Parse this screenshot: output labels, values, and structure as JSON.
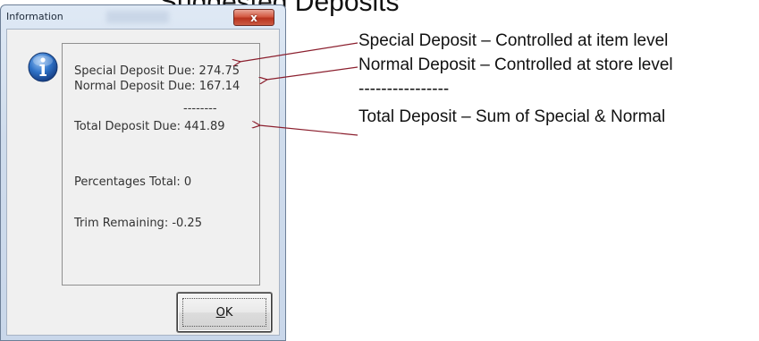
{
  "slide": {
    "title": "Suggested Deposits"
  },
  "dialog": {
    "title": "Information",
    "close_label": "x",
    "lines": {
      "special": "Special Deposit Due: 274.75",
      "normal": "Normal Deposit Due: 167.14",
      "separator": "--------",
      "total": "Total Deposit Due:   441.89",
      "percentages": "Percentages Total:  0",
      "trim": "Trim Remaining:  -0.25"
    },
    "ok_label_first": "O",
    "ok_label_rest": "K"
  },
  "annotations": {
    "special": "Special Deposit – Controlled at item level",
    "normal": "Normal Deposit – Controlled at store level",
    "separator": "----------------",
    "total": "Total Deposit – Sum of Special & Normal"
  },
  "colors": {
    "arrow": "#8b1f2e",
    "icon_blue": "#1e5fb4"
  },
  "icons": {
    "info": "info-icon",
    "close": "close-icon"
  }
}
